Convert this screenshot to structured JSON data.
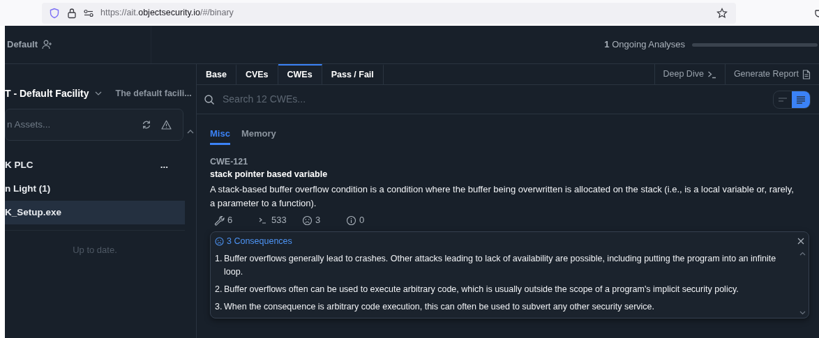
{
  "browser": {
    "url": {
      "prefix": "https://ait.",
      "domain": "objectsecurity.io",
      "suffix": "/#/binary"
    }
  },
  "header": {
    "workspace": "Default",
    "ongoing_count": "1",
    "ongoing_label": "Ongoing Analyses",
    "progress": {
      "level": 1
    }
  },
  "sidebar": {
    "facility_name": "T - Default Facility",
    "facility_description": "The default facili...",
    "search": {
      "placeholder": "n Assets..."
    },
    "tree": [
      {
        "label": "K PLC",
        "menu": "...",
        "selected": false,
        "children": [
          {
            "label": "n Light (1)",
            "selected": false,
            "children": [
              {
                "label": "K_Setup.exe",
                "selected": true
              }
            ]
          }
        ]
      }
    ],
    "status": "Up to date."
  },
  "tabs": [
    {
      "label": "Base",
      "selected": false
    },
    {
      "label": "CVEs",
      "selected": false
    },
    {
      "label": "CWEs",
      "selected": true
    },
    {
      "label": "Pass / Fail",
      "selected": false
    }
  ],
  "actions": [
    {
      "kind": "terminal",
      "label": "Deep Dive"
    },
    {
      "kind": "report",
      "label": "Generate Report"
    }
  ],
  "search": {
    "placeholder": "Search 12 CWEs..."
  },
  "view_toggle": [
    {
      "kind": "compact",
      "selected": false
    },
    {
      "kind": "detailed",
      "selected": true
    }
  ],
  "subtabs": [
    {
      "label": "Misc",
      "selected": true
    },
    {
      "label": "Memory",
      "selected": false
    }
  ],
  "cwe": {
    "id": "CWE-121",
    "title": "stack pointer based variable",
    "description": "A stack-based buffer overflow condition is a condition where the buffer being overwritten is allocated on the stack (i.e., is a local variable or, rarely, a parameter to a function).",
    "stats": [
      {
        "kind": "wrench",
        "value": "6"
      },
      {
        "kind": "terminal",
        "value": "533"
      },
      {
        "kind": "frown",
        "value": "3"
      },
      {
        "kind": "info",
        "value": "0"
      }
    ]
  },
  "consequences": {
    "title": "3 Consequences",
    "items": [
      {
        "number": "1.",
        "text": "Buffer overflows generally lead to crashes. Other attacks leading to lack of availability are possible, including putting the program into an infinite loop."
      },
      {
        "number": "2.",
        "text": "Buffer overflows often can be used to execute arbitrary code, which is usually outside the scope of a program's implicit security policy."
      },
      {
        "number": "3.",
        "text": "When the consequence is arbitrary code execution, this can often be used to subvert any other security service."
      }
    ]
  }
}
